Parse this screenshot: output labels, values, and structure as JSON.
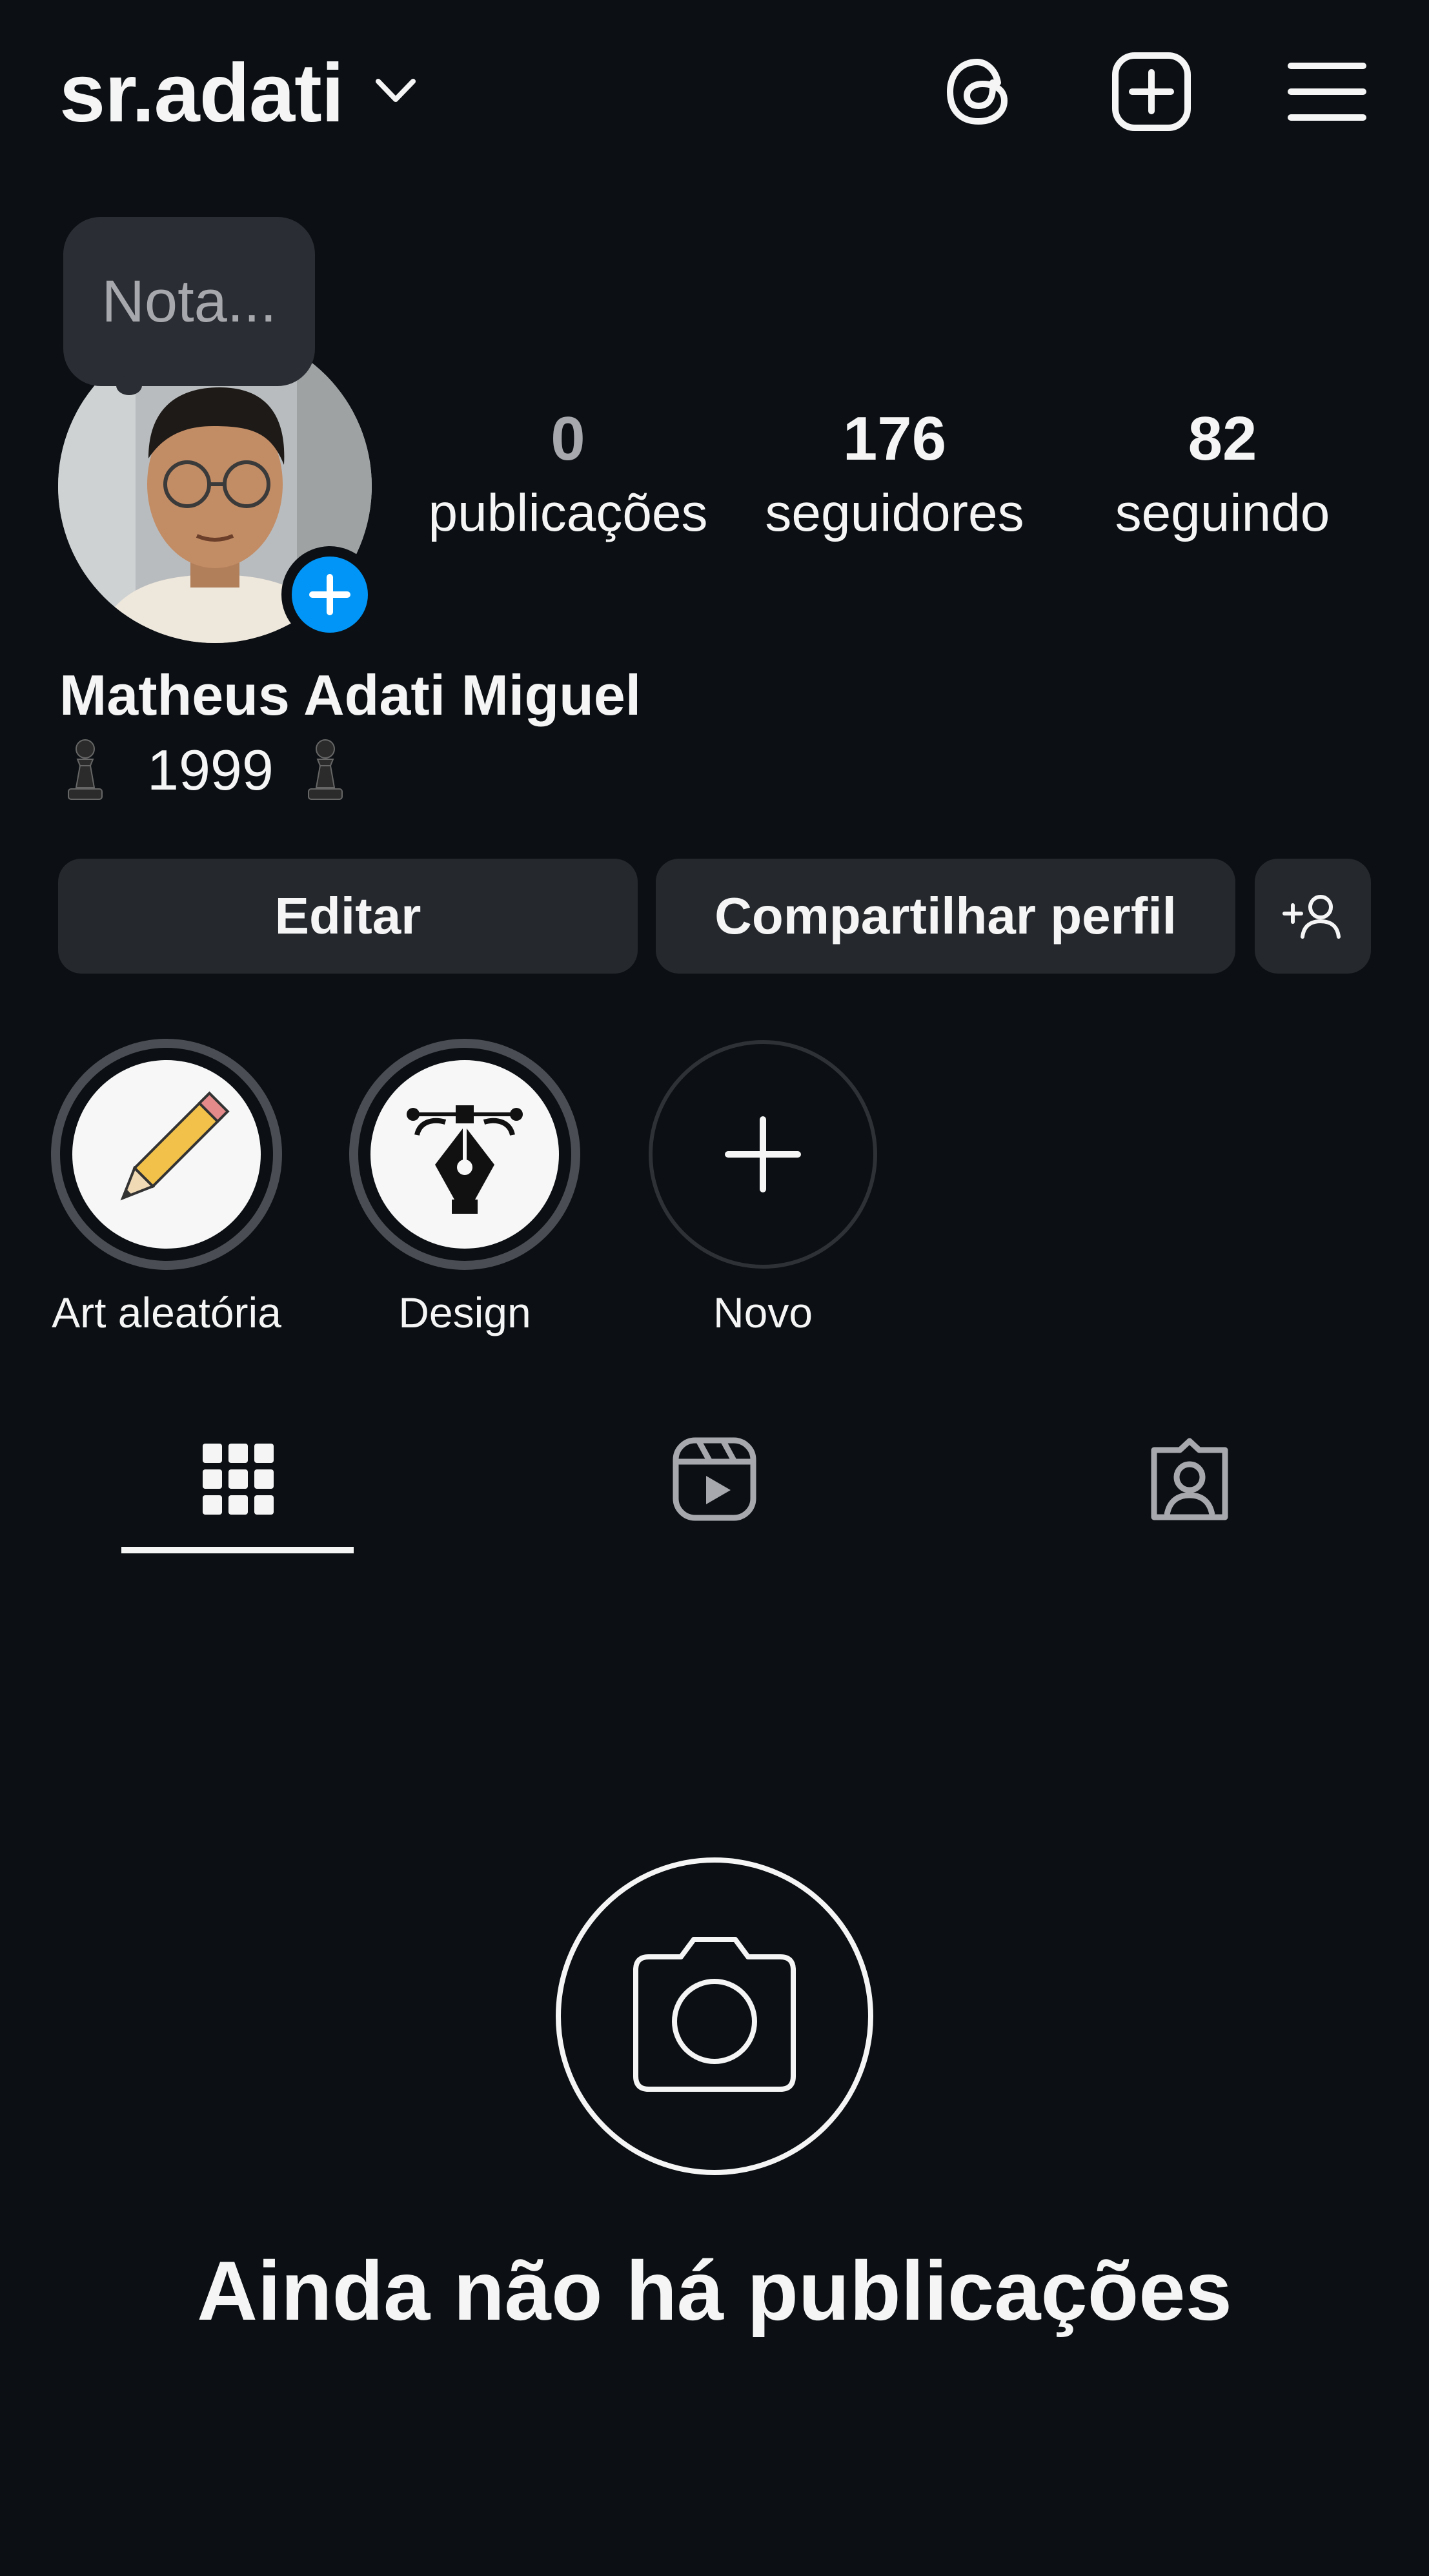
{
  "header": {
    "username": "sr.adati"
  },
  "note": {
    "placeholder": "Nota..."
  },
  "stats": [
    {
      "value": "0",
      "label": "publicações"
    },
    {
      "value": "176",
      "label": "seguidores"
    },
    {
      "value": "82",
      "label": "seguindo"
    }
  ],
  "profile": {
    "full_name": "Matheus Adati Miguel",
    "bio_text": "1999"
  },
  "buttons": {
    "edit": "Editar",
    "share": "Compartilhar perfil"
  },
  "highlights": [
    {
      "label": "Art aleatória",
      "icon": "pencil-icon"
    },
    {
      "label": "Design",
      "icon": "pen-tool-icon"
    },
    {
      "label": "Novo",
      "icon": "plus-icon"
    }
  ],
  "tabs": [
    "grid-icon",
    "reels-icon",
    "tagged-icon"
  ],
  "empty_state": {
    "title": "Ainda não há publicações"
  },
  "colors": {
    "background": "#0c1014",
    "button": "#25292e",
    "accent": "#0095f6"
  }
}
